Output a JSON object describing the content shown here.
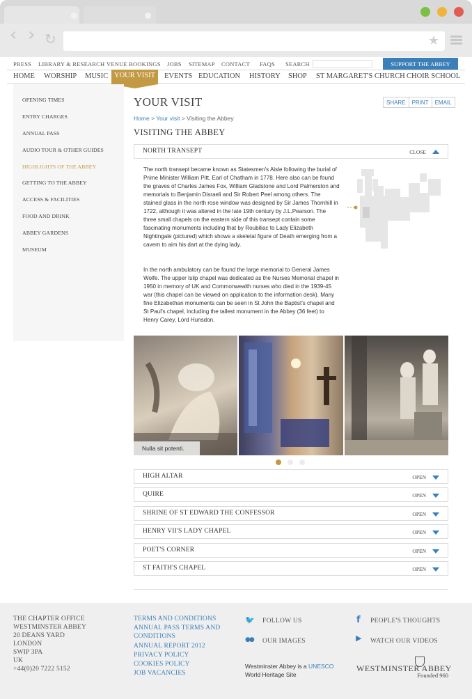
{
  "colors": {
    "accent_gold": "#c39a43",
    "link_blue": "#3b7fb8",
    "chrome_gray": "#d9d9d9"
  },
  "browser": {
    "icons": [
      "back-icon",
      "forward-icon",
      "reload-icon",
      "bookmark-star-icon",
      "menu-icon"
    ],
    "back_glyph": "‹",
    "forward_glyph": "›",
    "reload_glyph": "↻",
    "star_glyph": "★"
  },
  "utility": {
    "links": [
      "PRESS",
      "LIBRARY & RESEARCH",
      "VENUE BOOKINGS",
      "JOBS",
      "SITEMAP",
      "CONTACT",
      "FAQS",
      "SEARCH"
    ],
    "support": "SUPPORT THE ABBEY"
  },
  "nav": {
    "items": [
      "HOME",
      "WORSHIP",
      "MUSIC",
      "YOUR VISIT",
      "EVENTS",
      "EDUCATION",
      "HISTORY",
      "SHOP",
      "ST MARGARET'S CHURCH",
      "CHOIR SCHOOL"
    ],
    "active": "YOUR VISIT"
  },
  "sidebar": {
    "items": [
      "OPENING TIMES",
      "ENTRY CHARGES",
      "ANNUAL PASS",
      "AUDIO TOUR & OTHER GUIDES",
      "HIGHLIGHTS OF THE ABBEY",
      "GETTING TO THE ABBEY",
      "ACCESS & FACILITIES",
      "FOOD AND DRINK",
      "ABBEY GARDENS",
      "MUSEUM"
    ],
    "active": "HIGHLIGHTS OF THE ABBEY"
  },
  "page": {
    "title": "YOUR VISIT",
    "share": [
      "SHARE",
      "PRINT",
      "EMAIL"
    ],
    "breadcrumb": {
      "home": "Home",
      "sep": ">",
      "section": "Your visit",
      "current": "Visiting the Abbey"
    },
    "section_title": "VISITING THE ABBEY"
  },
  "accordion_open": {
    "title": "NORTH TRANSEPT",
    "action": "CLOSE",
    "paragraphs": [
      "The north transept became known as Statesmen's Aisle following the burial of Prime Minister William Pitt, Earl of Chatham in 1778. Here also can be found the graves of Charles James Fox, William Gladstone and Lord Palmerston and memorials to Benjamin Disraeli and Sir Robert Peel among others. The stained glass in the north rose window was designed by Sir James Thornhill in 1722, although it was altered in the late 19th century by J.L.Pearson. The three small chapels on the eastern side of this transept contain some fascinating monuments including that by Roubiliac to Lady Elizabeth Nightingale (pictured) which shows a skeletal figure of Death emerging from a cavern to aim his dart at the dying lady.",
      "In the north ambulatory can be found the large memorial to General James Wolfe.  The upper Islip chapel was dedicated as the Nurses Memorial chapel in 1950 in memory of UK and Commonwealth nurses who died in the 1939-45 war (this chapel can be viewed on application to the information desk). Many fine Elizabethan monuments can be seen in St John the Baptist's chapel and St Paul's chapel, including the tallest monument in the Abbey (36 feet) to Henry Carey, Lord Hunsdon."
    ],
    "gallery_caption": "Nulla sit potenti.",
    "slides": {
      "count": 3,
      "active": 1
    }
  },
  "accordion_closed": [
    {
      "title": "HIGH ALTAR",
      "action": "OPEN"
    },
    {
      "title": "QUIRE",
      "action": "OPEN"
    },
    {
      "title": "SHRINE OF ST EDWARD THE CONFESSOR",
      "action": "OPEN"
    },
    {
      "title": "HENRY VII'S LADY CHAPEL",
      "action": "OPEN"
    },
    {
      "title": "POET'S CORNER",
      "action": "OPEN"
    },
    {
      "title": "ST FAITH'S CHAPEL",
      "action": "OPEN"
    }
  ],
  "footer": {
    "address": [
      "THE CHAPTER OFFICE",
      "WESTMINSTER ABBEY",
      "20 DEANS YARD",
      "LONDON",
      "SWIP 3PA",
      "UK",
      "+44(0)20 7222 5152"
    ],
    "links": [
      "TERMS AND CONDITIONS",
      "ANNUAL PASS TERMS AND",
      "CONDITIONS",
      "ANNUAL REPORT 2012",
      "PRIVACY POLICY",
      "COOKIES POLICY",
      "JOB VACANCIES"
    ],
    "social": [
      {
        "icon": "twitter-icon",
        "glyph": "🐦",
        "label": "FOLLOW US"
      },
      {
        "icon": "flickr-icon",
        "glyph": "●●",
        "label": "OUR IMAGES"
      },
      {
        "icon": "facebook-icon",
        "glyph": "f",
        "label": "PEOPLE'S THOUGHTS"
      },
      {
        "icon": "youtube-icon",
        "glyph": "▶",
        "label": "WATCH OUR VIDEOS"
      }
    ],
    "unesco": {
      "prefix": "Westminster Abbey is a",
      "link": "UNESCO",
      "suffix": "World Heritage Site"
    },
    "logo": {
      "name": "WESTMINSTER ABBEY",
      "sub": "Founded 960"
    }
  }
}
